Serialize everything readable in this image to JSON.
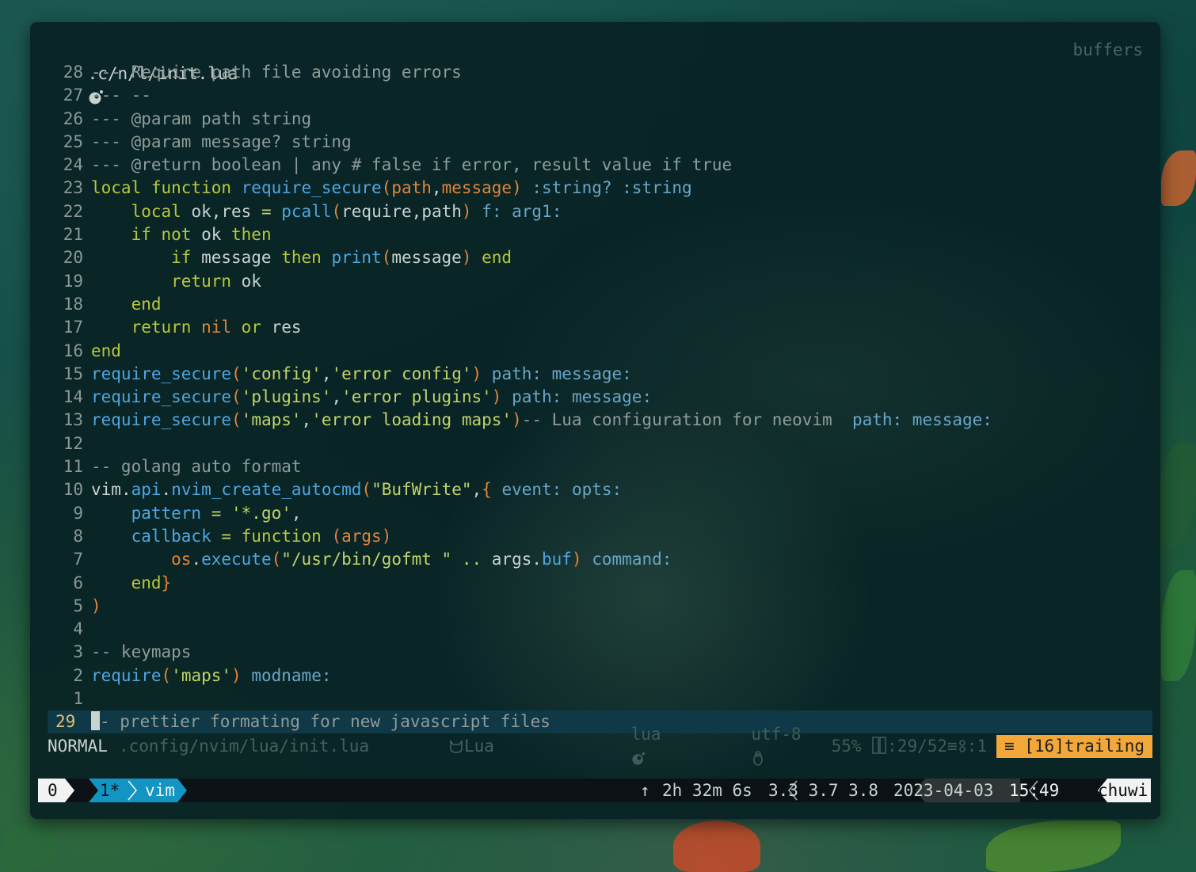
{
  "header": {
    "filename": ".c/n/l/init.lua",
    "file_icon": "lua-moon-icon",
    "buffers_label": "buffers"
  },
  "lines": [
    {
      "n": "28",
      "seg": [
        [
          "--- Require path file avoiding errors",
          "com"
        ]
      ]
    },
    {
      "n": "27",
      "seg": [
        [
          "--- --",
          "com"
        ]
      ]
    },
    {
      "n": "26",
      "seg": [
        [
          "--- @param path string",
          "com"
        ]
      ]
    },
    {
      "n": "25",
      "seg": [
        [
          "--- @param message? string",
          "com"
        ]
      ]
    },
    {
      "n": "24",
      "seg": [
        [
          "--- @return boolean | any # false if error, result value if true",
          "com"
        ]
      ]
    },
    {
      "n": "23",
      "seg": [
        [
          "local function ",
          "kw"
        ],
        [
          "require_secure",
          "fn"
        ],
        [
          "(",
          "par"
        ],
        [
          "path",
          "par"
        ],
        [
          ",",
          "id"
        ],
        [
          "message",
          "par"
        ],
        [
          ")",
          "par"
        ],
        [
          " :string? :string",
          "hint"
        ]
      ]
    },
    {
      "n": "22",
      "seg": [
        [
          "    local ",
          "kw"
        ],
        [
          "ok",
          "id"
        ],
        [
          ",",
          "id"
        ],
        [
          "res",
          "id"
        ],
        [
          " = ",
          "op"
        ],
        [
          "pcall",
          "fn"
        ],
        [
          "(",
          "par"
        ],
        [
          "require",
          "id"
        ],
        [
          ",",
          "id"
        ],
        [
          "path",
          "id"
        ],
        [
          ")",
          "par"
        ],
        [
          " f: arg1:",
          "hint"
        ]
      ]
    },
    {
      "n": "21",
      "seg": [
        [
          "    if not ",
          "kw"
        ],
        [
          "ok",
          "id"
        ],
        [
          " then",
          "kw"
        ]
      ]
    },
    {
      "n": "20",
      "seg": [
        [
          "        if ",
          "kw"
        ],
        [
          "message",
          "id"
        ],
        [
          " then ",
          "kw"
        ],
        [
          "print",
          "fn"
        ],
        [
          "(",
          "par"
        ],
        [
          "message",
          "id"
        ],
        [
          ")",
          "par"
        ],
        [
          " end",
          "kw"
        ]
      ]
    },
    {
      "n": "19",
      "seg": [
        [
          "        return ",
          "kw"
        ],
        [
          "ok",
          "id"
        ]
      ]
    },
    {
      "n": "18",
      "seg": [
        [
          "    end",
          "kw"
        ]
      ]
    },
    {
      "n": "17",
      "seg": [
        [
          "    return ",
          "kw"
        ],
        [
          "nil",
          "par"
        ],
        [
          " or ",
          "kw"
        ],
        [
          "res",
          "id"
        ]
      ]
    },
    {
      "n": "16",
      "seg": [
        [
          "end",
          "kw"
        ]
      ]
    },
    {
      "n": "15",
      "seg": [
        [
          "require_secure",
          "fn"
        ],
        [
          "(",
          "par"
        ],
        [
          "'config'",
          "str"
        ],
        [
          ",",
          "id"
        ],
        [
          "'error config'",
          "str"
        ],
        [
          ")",
          "par"
        ],
        [
          " path: message:",
          "hint"
        ]
      ]
    },
    {
      "n": "14",
      "seg": [
        [
          "require_secure",
          "fn"
        ],
        [
          "(",
          "par"
        ],
        [
          "'plugins'",
          "str"
        ],
        [
          ",",
          "id"
        ],
        [
          "'error plugins'",
          "str"
        ],
        [
          ")",
          "par"
        ],
        [
          " path: message:",
          "hint"
        ]
      ]
    },
    {
      "n": "13",
      "seg": [
        [
          "require_secure",
          "fn"
        ],
        [
          "(",
          "par"
        ],
        [
          "'maps'",
          "str"
        ],
        [
          ",",
          "id"
        ],
        [
          "'error loading maps'",
          "str"
        ],
        [
          ")",
          "par"
        ],
        [
          "-- Lua configuration for neovim ",
          "com"
        ],
        [
          " path: message:",
          "hint"
        ]
      ]
    },
    {
      "n": "12",
      "seg": []
    },
    {
      "n": "11",
      "seg": [
        [
          "-- golang auto format",
          "com"
        ]
      ]
    },
    {
      "n": "10",
      "seg": [
        [
          "vim",
          "id"
        ],
        [
          ".",
          "id"
        ],
        [
          "api",
          "fn"
        ],
        [
          ".",
          "id"
        ],
        [
          "nvim_create_autocmd",
          "fn"
        ],
        [
          "(",
          "par"
        ],
        [
          "\"BufWrite\"",
          "str"
        ],
        [
          ",",
          "id"
        ],
        [
          "{",
          "par"
        ],
        [
          " event: opts:",
          "hint"
        ]
      ]
    },
    {
      "n": "9",
      "seg": [
        [
          "    pattern",
          "field"
        ],
        [
          " = ",
          "op"
        ],
        [
          "'*.go'",
          "str"
        ],
        [
          ",",
          "id"
        ]
      ]
    },
    {
      "n": "8",
      "seg": [
        [
          "    callback",
          "field"
        ],
        [
          " = ",
          "op"
        ],
        [
          "function ",
          "kw"
        ],
        [
          "(",
          "par"
        ],
        [
          "args",
          "par"
        ],
        [
          ")",
          "par"
        ]
      ]
    },
    {
      "n": "7",
      "seg": [
        [
          "        os",
          "par"
        ],
        [
          ".",
          "id"
        ],
        [
          "execute",
          "fn"
        ],
        [
          "(",
          "par"
        ],
        [
          "\"/usr/bin/gofmt \"",
          "str"
        ],
        [
          " .. ",
          "op"
        ],
        [
          "args",
          "id"
        ],
        [
          ".",
          "id"
        ],
        [
          "buf",
          "fn"
        ],
        [
          ")",
          "par"
        ],
        [
          " command:",
          "hint"
        ]
      ]
    },
    {
      "n": "6",
      "seg": [
        [
          "    end",
          "kw"
        ],
        [
          "}",
          "par"
        ]
      ]
    },
    {
      "n": "5",
      "seg": [
        [
          ")",
          "par"
        ]
      ]
    },
    {
      "n": "4",
      "seg": []
    },
    {
      "n": "3",
      "seg": [
        [
          "-- keymaps",
          "com"
        ]
      ]
    },
    {
      "n": "2",
      "seg": [
        [
          "require",
          "fn"
        ],
        [
          "(",
          "par"
        ],
        [
          "'maps'",
          "str"
        ],
        [
          ")",
          "par"
        ],
        [
          " modname:",
          "hint"
        ]
      ]
    },
    {
      "n": "1",
      "seg": []
    }
  ],
  "current_line": {
    "number": "29",
    "text": "- prettier formating for new javascript files"
  },
  "statusline": {
    "mode": "NORMAL",
    "path": ".config/nvim/lua/init.lua",
    "filetype": "Lua",
    "filetype_right": "lua",
    "encoding": "utf-8",
    "percent": "55%",
    "position": ":29/52≡",
    "column": ":1",
    "trailing": "≡ [16]trailing"
  },
  "tmux": {
    "session": "0",
    "window_index": "1*",
    "window_name": "vim",
    "uptime": "2h 32m 6s",
    "load": "3.3 3.7 3.8",
    "date": "2023-04-03",
    "time": "15:49",
    "host": "chuwi",
    "colors": {
      "bar": "#0b1114",
      "active": "#1395c3",
      "white": "#f2f2f2",
      "mid": "#2f3437"
    }
  },
  "colors": {
    "accent": "#f3a738",
    "cursorline": "#0f3946"
  }
}
